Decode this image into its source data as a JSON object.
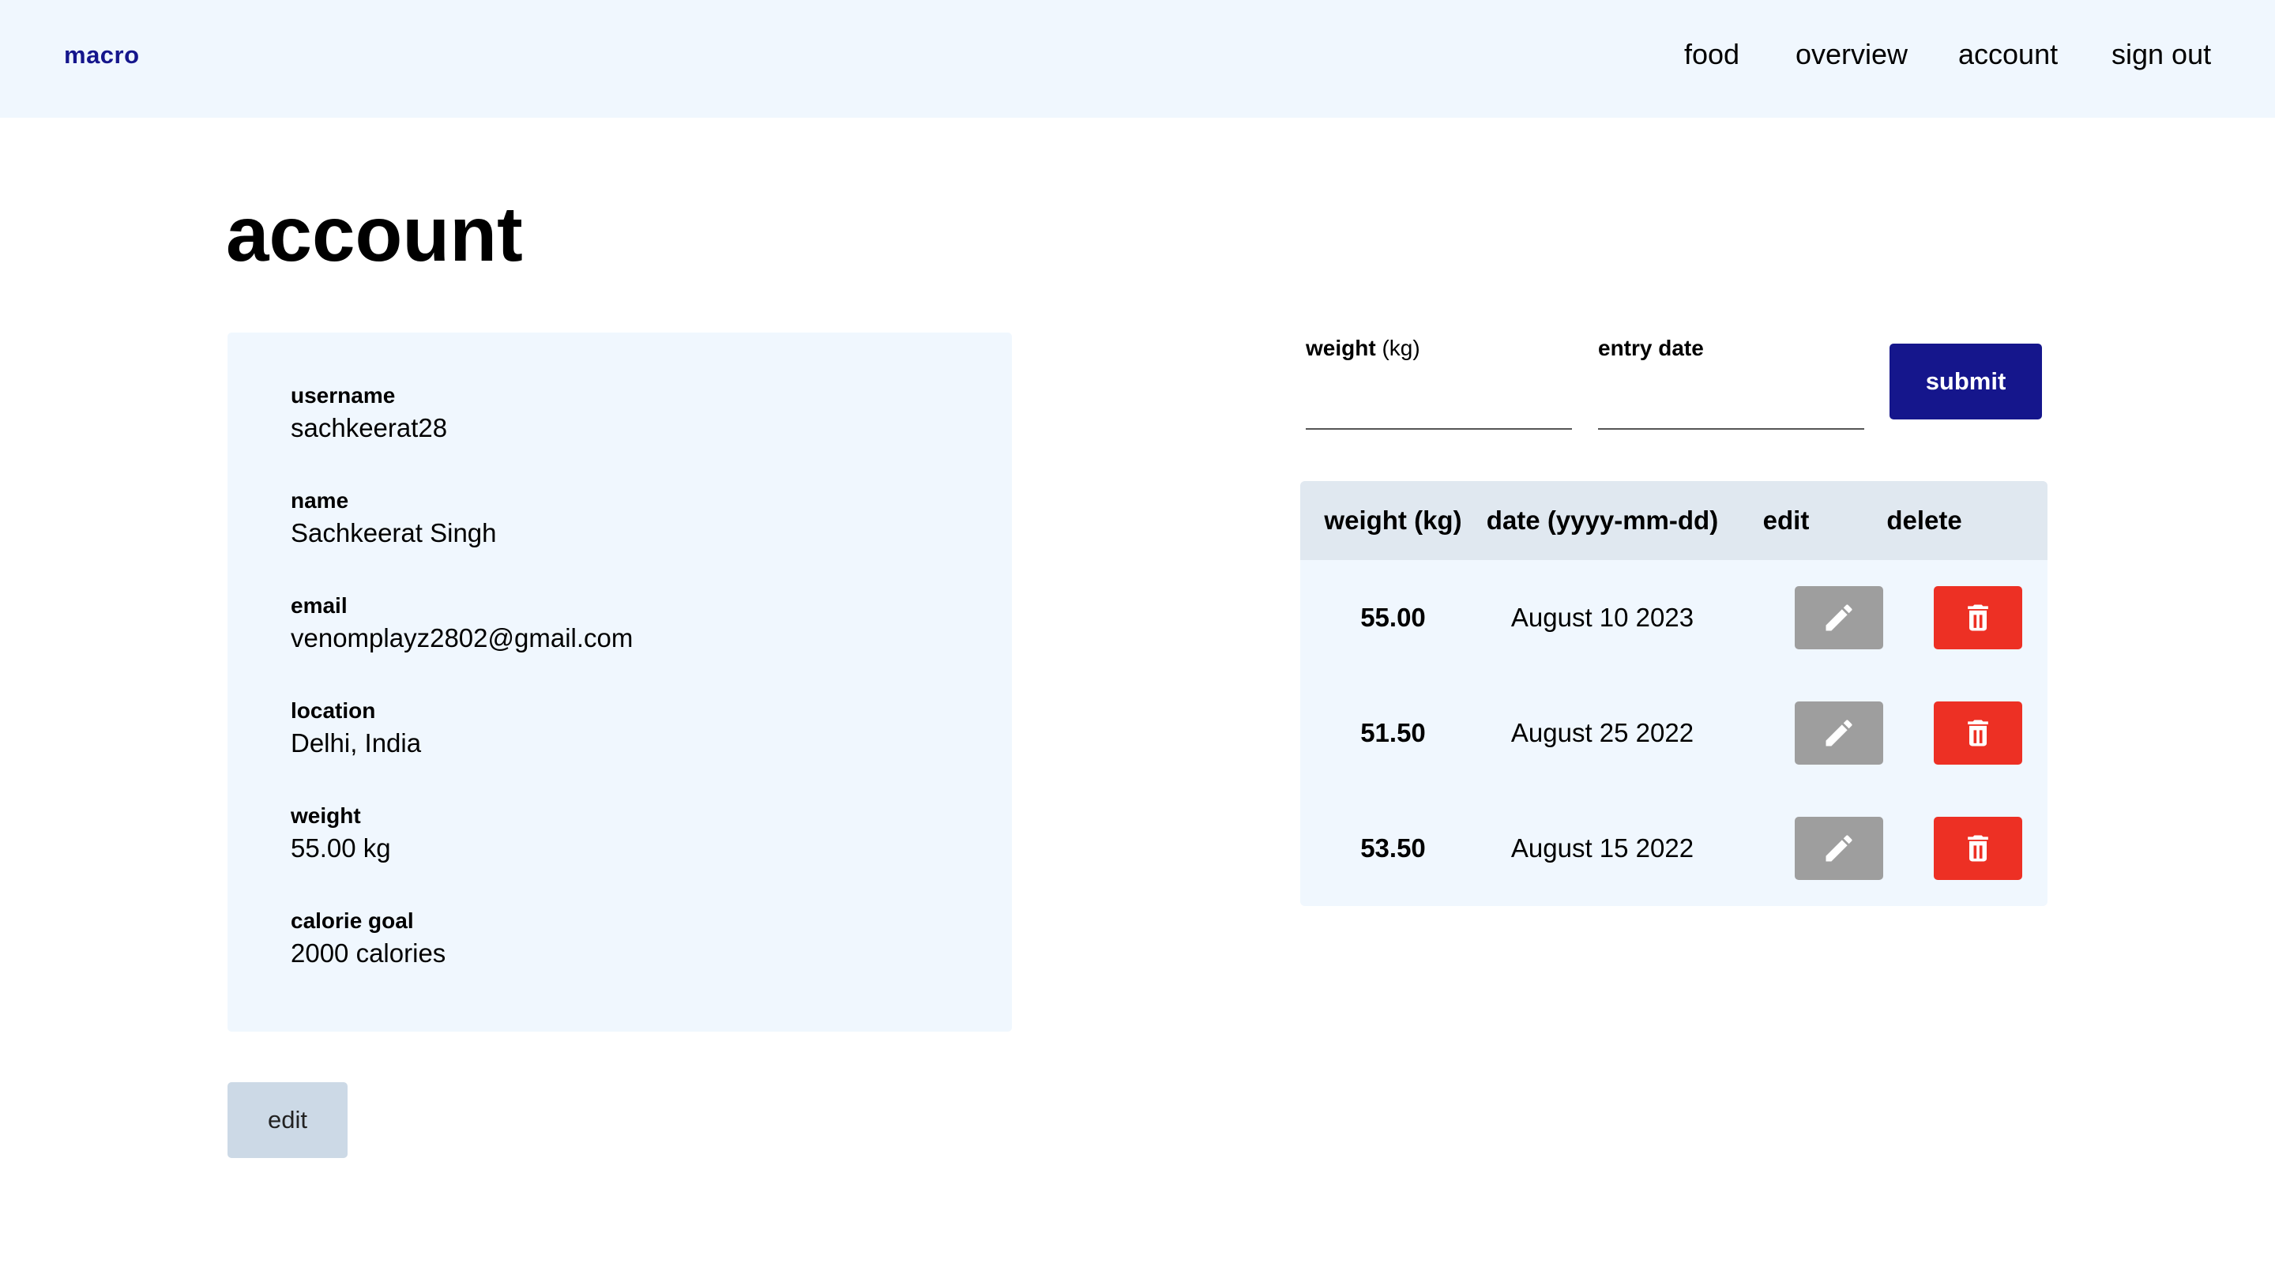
{
  "nav": {
    "brand": "macro",
    "links": [
      "food",
      "overview",
      "account",
      "sign out"
    ]
  },
  "page_title": "account",
  "profile": {
    "fields": [
      {
        "label": "username",
        "value": "sachkeerat28"
      },
      {
        "label": "name",
        "value": "Sachkeerat Singh"
      },
      {
        "label": "email",
        "value": "venomplayz2802@gmail.com"
      },
      {
        "label": "location",
        "value": "Delhi, India"
      },
      {
        "label": "weight",
        "value": "55.00 kg"
      },
      {
        "label": "calorie goal",
        "value": "2000 calories"
      }
    ],
    "edit_label": "edit"
  },
  "form": {
    "weight_label_bold": "weight",
    "weight_label_unit": " (kg)",
    "weight_value": "",
    "date_label": "entry date",
    "date_value": "",
    "submit_label": "submit"
  },
  "table": {
    "headers": [
      "weight (kg)",
      "date (yyyy-mm-dd)",
      "edit",
      "delete"
    ],
    "rows": [
      {
        "weight": "55.00",
        "date": "August 10 2023"
      },
      {
        "weight": "51.50",
        "date": "August 25 2022"
      },
      {
        "weight": "53.50",
        "date": "August 15 2022"
      }
    ]
  },
  "colors": {
    "navbar_bg": "#f0f7fe",
    "brand": "#15168c",
    "submit_bg": "#15168c",
    "edit_icon_bg": "#9e9e9e",
    "delete_icon_bg": "#ed3024",
    "edit_account_bg": "#ccd9e6"
  },
  "icons": {
    "row_edit": "pencil-icon",
    "row_delete": "trash-icon"
  }
}
